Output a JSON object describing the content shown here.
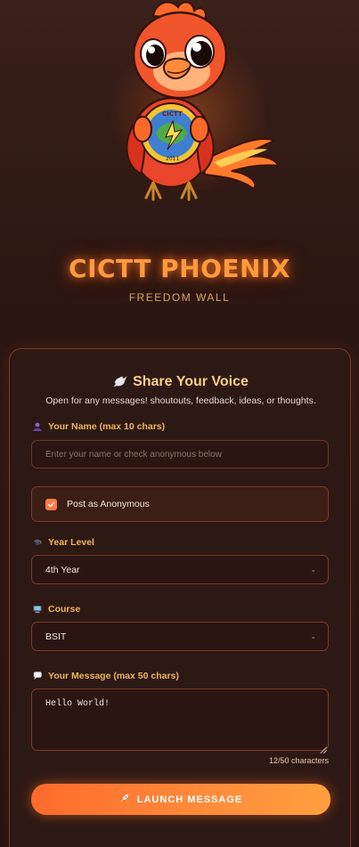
{
  "header": {
    "title": "CICTT PHOENIX",
    "subtitle": "FREEDOM WALL",
    "mascot_icon": "phoenix-mascot-icon"
  },
  "form": {
    "title": "Share Your Voice",
    "title_icon": "dove-icon",
    "description": "Open for any messages! shoutouts, feedback, ideas, or thoughts.",
    "name": {
      "label": "Your Name (max 10 chars)",
      "icon": "user-icon",
      "placeholder": "Enter your name or check anonymous below",
      "value": ""
    },
    "anonymous": {
      "label": "Post as Anonymous",
      "checked": true
    },
    "year_level": {
      "label": "Year Level",
      "icon": "graduation-icon",
      "value": "4th Year"
    },
    "course": {
      "label": "Course",
      "icon": "computer-icon",
      "value": "BSIT"
    },
    "message": {
      "label": "Your Message (max 50 chars)",
      "icon": "chat-bubble-icon",
      "value": "Hello World!",
      "char_count": "12/50 characters"
    },
    "submit": {
      "label": "LAUNCH MESSAGE",
      "icon": "rocket-icon"
    }
  },
  "colors": {
    "accent": "#ff7a45",
    "title_glow": "#ff9a3c",
    "label": "#f0b55c",
    "border": "#7a3a22"
  }
}
